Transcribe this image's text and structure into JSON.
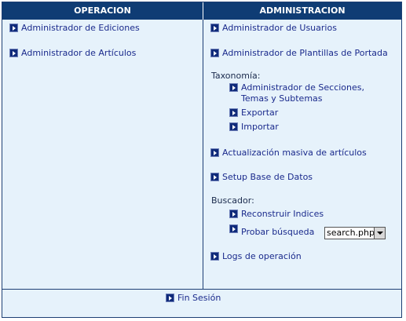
{
  "headers": {
    "operacion": "OPERACION",
    "administracion": "ADMINISTRACION"
  },
  "operacion": {
    "ediciones": "Administrador de Ediciones",
    "articulos": "Administrador de Artículos"
  },
  "administracion": {
    "usuarios": "Administrador de Usuarios",
    "plantillas": "Administrador de Plantillas de Portada",
    "taxonomia_label": "Taxonomía:",
    "taxonomia": {
      "secciones": "Administrador de Secciones, Temas y Subtemas",
      "exportar": "Exportar",
      "importar": "Importar"
    },
    "actualizacion": "Actualización masiva de artículos",
    "setup": "Setup Base de Datos",
    "buscador_label": "Buscador:",
    "buscador": {
      "reconstruir": "Reconstruir Indices",
      "probar": "Probar búsqueda",
      "select_value": "search.php"
    },
    "logs": "Logs de operación"
  },
  "footer": {
    "fin_sesion": "Fin Sesión"
  },
  "colors": {
    "header_bg": "#0f3c74",
    "panel_bg": "#e6f2fb",
    "link": "#1a2a8c"
  },
  "icons": {
    "bullet": "arrow-right-icon",
    "dropdown": "chevron-down-icon"
  }
}
